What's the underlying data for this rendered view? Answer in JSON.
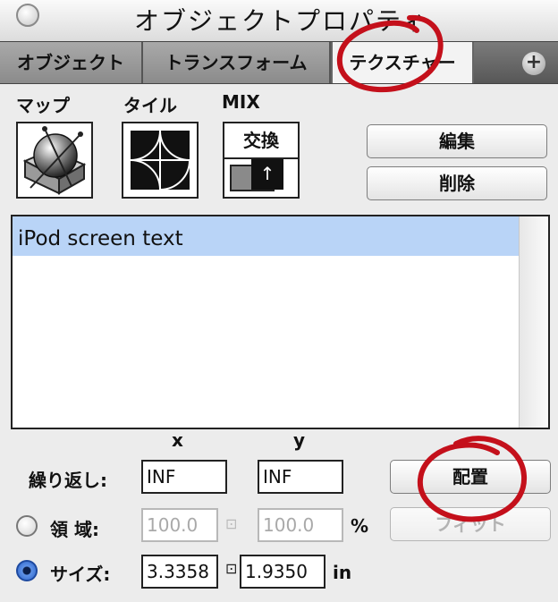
{
  "window": {
    "title": "オブジェクトプロパティ"
  },
  "tabs": [
    {
      "label": "オブジェクト",
      "active": false
    },
    {
      "label": "トランスフォーム",
      "active": false
    },
    {
      "label": "テクスチャー",
      "active": true
    }
  ],
  "tab_add_glyph": "+",
  "texture": {
    "map_label": "マップ",
    "tile_label": "タイル",
    "mix_label": "MIX",
    "mix_swap_label": "交換",
    "mix_arrow": "↑",
    "edit_button": "編集",
    "delete_button": "削除"
  },
  "list": {
    "items": [
      "iPod screen text"
    ]
  },
  "coords": {
    "x_label": "x",
    "y_label": "y"
  },
  "repeat": {
    "label": "繰り返し:",
    "x": "INF",
    "y": "INF"
  },
  "place_button": "配置",
  "area": {
    "label": "領 域:",
    "x": "100.0",
    "y": "100.0",
    "unit": "%",
    "selected": false
  },
  "fit_button": "フィット",
  "size": {
    "label": "サイズ:",
    "x": "3.3358",
    "y": "1.9350",
    "unit": "in",
    "selected": true
  },
  "lock_glyph": "⊡",
  "colors": {
    "selection": "#b9d4f7",
    "annotation": "#c4101b",
    "radio_on": "#2d63c8"
  },
  "icons": {
    "map": "sphere-map-icon",
    "tile": "tile-quarter-circles-icon",
    "mix": "mix-swap-icon",
    "lock": "lock-icon"
  }
}
